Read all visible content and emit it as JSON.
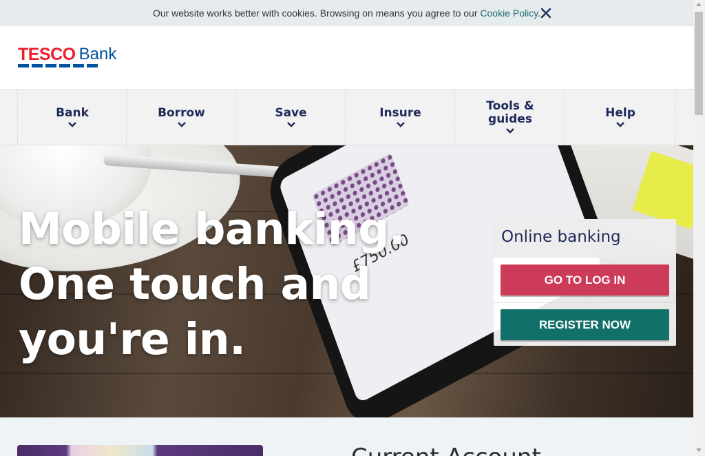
{
  "cookie_bar": {
    "text": "Our website works better with cookies. Browsing on means you agree to our ",
    "link": "Cookie Policy",
    "suffix": ".",
    "close_icon": "close-icon"
  },
  "brand": {
    "primary": "TESCO",
    "secondary": "Bank",
    "colors": {
      "tesco_red": "#ee1c2e",
      "tesco_blue": "#00539f"
    }
  },
  "nav": {
    "items": [
      {
        "label": "Bank",
        "icon": "chevron-down-icon"
      },
      {
        "label": "Borrow",
        "icon": "chevron-down-icon"
      },
      {
        "label": "Save",
        "icon": "chevron-down-icon"
      },
      {
        "label": "Insure",
        "icon": "chevron-down-icon"
      },
      {
        "label": "Tools &\nguides",
        "icon": "chevron-down-icon"
      },
      {
        "label": "Help",
        "icon": "chevron-down-icon"
      }
    ]
  },
  "hero": {
    "lines": [
      "Mobile banking.",
      "One touch and",
      "you're in."
    ],
    "phone_balance": "£750.00"
  },
  "login_panel": {
    "title": "Online banking",
    "login_button": "GO TO LOG IN",
    "register_button": "REGISTER NOW",
    "colors": {
      "login": "#cc3b58",
      "register": "#12706a"
    }
  },
  "lower": {
    "heading": "Current Account"
  }
}
